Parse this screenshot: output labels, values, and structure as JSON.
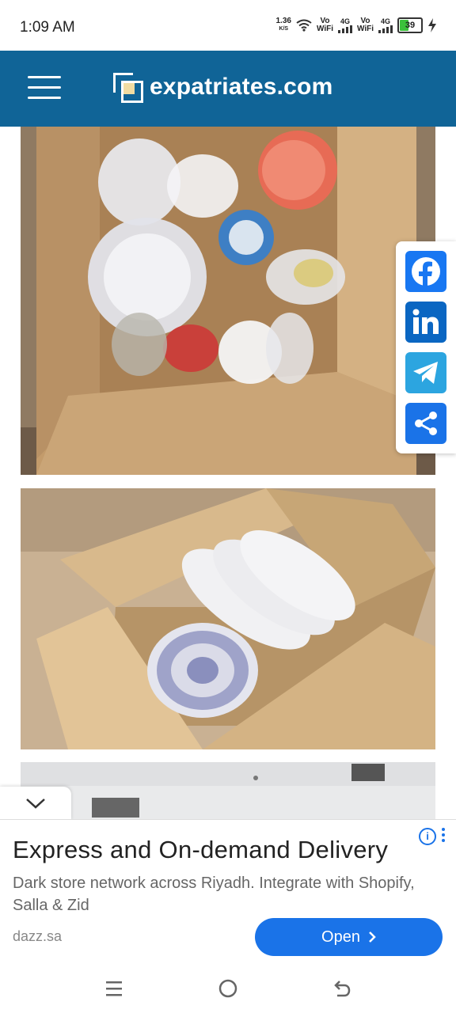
{
  "status_bar": {
    "time": "1:09 AM",
    "speed_value": "1.36",
    "speed_unit": "K/S",
    "sim1_label_top": "Vo",
    "sim1_label_bottom": "WiFi",
    "sim1_network": "4G",
    "sim2_label_top": "Vo",
    "sim2_label_bottom": "WiFi",
    "sim2_network": "4G",
    "battery": "39"
  },
  "header": {
    "site_name": "expatriates.com"
  },
  "share": {
    "items": [
      "facebook-icon",
      "linkedin-icon",
      "telegram-icon",
      "share-icon"
    ]
  },
  "ad": {
    "title": "Express and On-demand Delivery",
    "description": "Dark store network across Riyadh. Integrate with Shopify, Salla & Zid",
    "domain": "dazz.sa",
    "button_label": "Open"
  },
  "colors": {
    "header": "#106497",
    "accent": "#1a73e8",
    "facebook": "#1877f2",
    "linkedin": "#0a66c2",
    "telegram": "#2ca5e0"
  }
}
